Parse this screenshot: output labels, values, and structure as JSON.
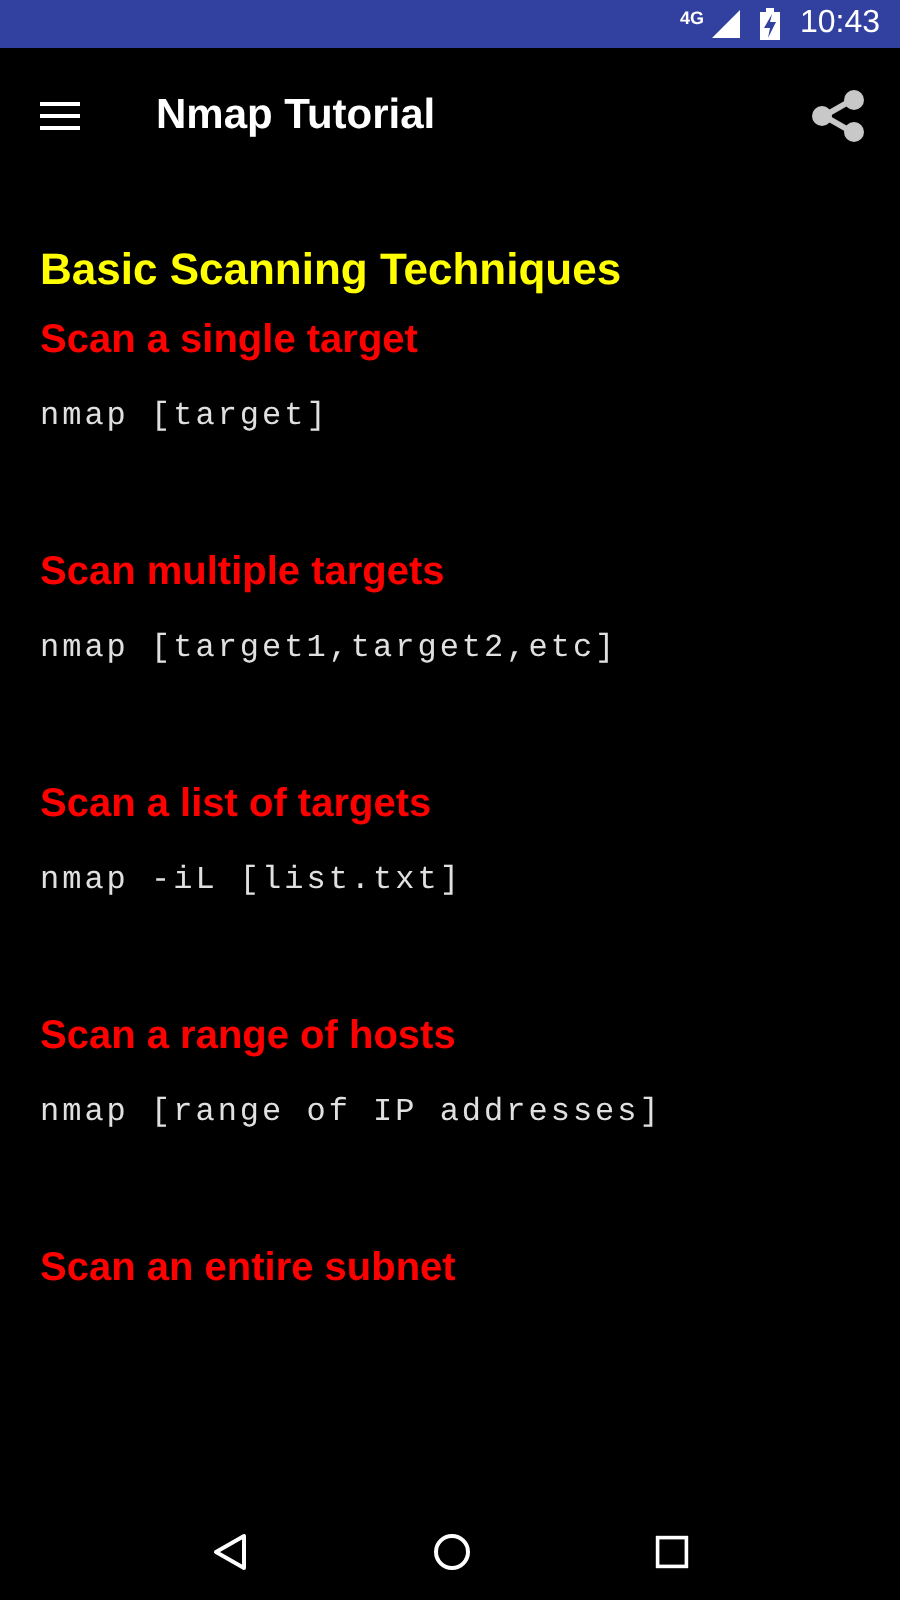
{
  "status_bar": {
    "network": "4G",
    "time": "10:43"
  },
  "app_bar": {
    "title": "Nmap Tutorial"
  },
  "heading": "Basic Scanning Techniques",
  "sections": [
    {
      "title": "Scan a single target",
      "command": "nmap [target]"
    },
    {
      "title": "Scan multiple targets",
      "command": "nmap [target1,target2,etc]"
    },
    {
      "title": "Scan a list of targets",
      "command": "nmap -iL [list.txt]"
    },
    {
      "title": "Scan a range of hosts",
      "command": "nmap [range of IP addresses]"
    },
    {
      "title": "Scan an entire subnet"
    }
  ]
}
